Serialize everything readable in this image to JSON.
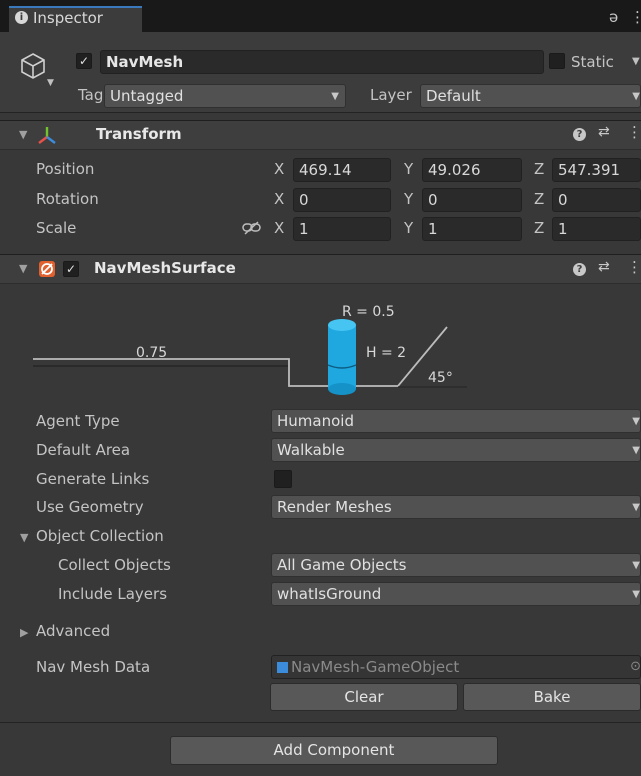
{
  "tab": {
    "title": "Inspector"
  },
  "header": {
    "object_name": "NavMesh",
    "static_label": "Static",
    "tag_label": "Tag",
    "tag_value": "Untagged",
    "layer_label": "Layer",
    "layer_value": "Default"
  },
  "transform": {
    "title": "Transform",
    "rows": [
      {
        "label": "Position",
        "x": "469.14",
        "y": "49.026",
        "z": "547.391"
      },
      {
        "label": "Rotation",
        "x": "0",
        "y": "0",
        "z": "0"
      },
      {
        "label": "Scale",
        "x": "1",
        "y": "1",
        "z": "1"
      }
    ],
    "axis_x": "X",
    "axis_y": "Y",
    "axis_z": "Z"
  },
  "navmesh_surface": {
    "title": "NavMeshSurface",
    "diagram": {
      "radius": "R = 0.5",
      "height": "H = 2",
      "step": "0.75",
      "slope": "45°"
    },
    "fields": {
      "agent_type_label": "Agent Type",
      "agent_type_value": "Humanoid",
      "default_area_label": "Default Area",
      "default_area_value": "Walkable",
      "generate_links_label": "Generate Links",
      "use_geometry_label": "Use Geometry",
      "use_geometry_value": "Render Meshes",
      "object_collection_label": "Object Collection",
      "collect_objects_label": "Collect Objects",
      "collect_objects_value": "All Game Objects",
      "include_layers_label": "Include Layers",
      "include_layers_value": "whatIsGround",
      "advanced_label": "Advanced",
      "nav_mesh_data_label": "Nav Mesh Data",
      "nav_mesh_data_value": "NavMesh-GameObject"
    },
    "clear_label": "Clear",
    "bake_label": "Bake"
  },
  "add_component_label": "Add Component",
  "colors": {
    "accent": "#3a79bb",
    "cylinder": "#1fa7e0",
    "panel": "#383838"
  }
}
